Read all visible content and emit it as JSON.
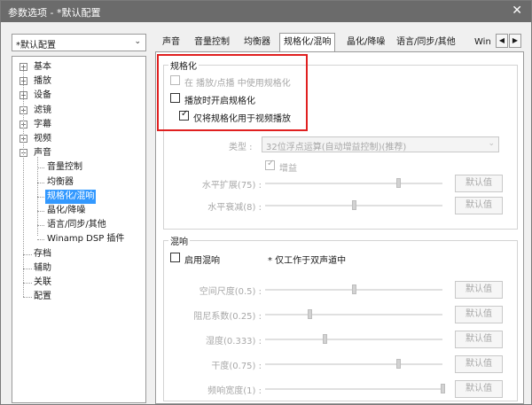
{
  "window": {
    "title": "参数选项 - *默认配置",
    "close_glyph": "✕"
  },
  "profile_combo": {
    "value": "*默认配置",
    "arrow": "⌄"
  },
  "tree": {
    "items": [
      {
        "label": "基本",
        "expander": "+"
      },
      {
        "label": "播放",
        "expander": "+"
      },
      {
        "label": "设备",
        "expander": "+"
      },
      {
        "label": "滤镜",
        "expander": "+"
      },
      {
        "label": "字幕",
        "expander": "+"
      },
      {
        "label": "视频",
        "expander": "+"
      },
      {
        "label": "声音",
        "expander": "−"
      },
      {
        "label": "音量控制"
      },
      {
        "label": "均衡器"
      },
      {
        "label": "规格化/混响",
        "selected": true
      },
      {
        "label": "晶化/降噪"
      },
      {
        "label": "语言/同步/其他"
      },
      {
        "label": "Winamp DSP 插件"
      },
      {
        "label": "存档"
      },
      {
        "label": "辅助"
      },
      {
        "label": "关联"
      },
      {
        "label": "配置"
      }
    ]
  },
  "tabs": {
    "items": [
      "声音",
      "音量控制",
      "均衡器",
      "规格化/混响",
      "晶化/降噪",
      "语言/同步/其他",
      "Win"
    ],
    "active": "规格化/混响",
    "scroll_left": "◀",
    "scroll_right": "▶"
  },
  "normalize": {
    "title": "规格化",
    "opt_use_in_play": "在 播放/点播 中使用规格化",
    "opt_enable_on_play": "播放时开启规格化",
    "opt_video_only": "仅将规格化用于视频播放",
    "check_mark": "✓",
    "type_label": "类型 :",
    "type_value": "32位浮点运算(自动增益控制)(推荐)",
    "select_arrow": "⌄",
    "gain_label": "增益",
    "sliders": [
      {
        "label": "水平扩展(75) :",
        "value": 75,
        "button": "默认值"
      },
      {
        "label": "水平衰减(8) :",
        "value": 8,
        "button": "默认值"
      }
    ]
  },
  "reverb": {
    "title": "混响",
    "enable_label": "启用混响",
    "note": "* 仅工作于双声道中",
    "sliders": [
      {
        "label": "空间尺度(0.5) :",
        "value": 0.5,
        "button": "默认值"
      },
      {
        "label": "阻尼系数(0.25) :",
        "value": 0.25,
        "button": "默认值"
      },
      {
        "label": "湿度(0.333) :",
        "value": 0.333,
        "button": "默认值"
      },
      {
        "label": "干度(0.75) :",
        "value": 0.75,
        "button": "默认值"
      },
      {
        "label": "频响宽度(1) :",
        "value": 1,
        "button": "默认值"
      }
    ]
  },
  "colors": {
    "title_bar": "#6b6b6b",
    "selection": "#3399ff",
    "highlight_box": "#e02020"
  }
}
